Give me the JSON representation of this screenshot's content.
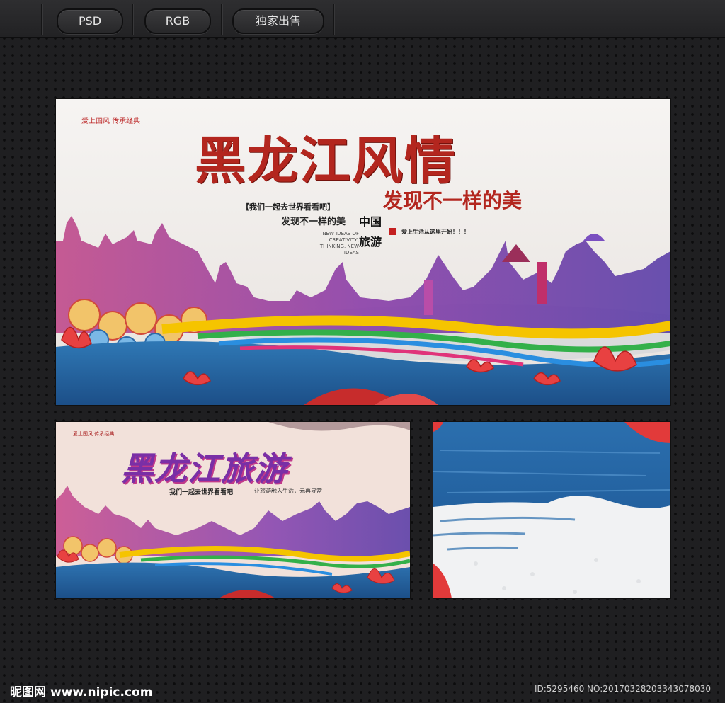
{
  "toolbar": {
    "format_label": "PSD",
    "color_mode_label": "RGB",
    "exclusive_label": "独家出售"
  },
  "poster_main": {
    "tagline_top": "爱上国风 传承经典",
    "title": "黑龙江风情",
    "subtitle": "发现不一样的美",
    "bracket_text": "【我们一起去世界看看吧】",
    "slogan": "发现不一样的美",
    "english_lines": [
      "NEW IDEAS OF",
      "CREATIVITY,",
      "THINKING, NEW IDEAS"
    ],
    "china_label": "中国",
    "travel_label": "旅游",
    "side_note": "爱上生活从这里开始！！！"
  },
  "poster_small": {
    "tagline_top": "爱上国风 传承经典",
    "title": "黑龙江旅游",
    "subtitle": "我们一起去世界看看吧",
    "side_note": "让旅游融入生活，元再寻常"
  },
  "footer": {
    "brand": "昵图网",
    "site": "www.nipic.com",
    "id_text": "ID:5295460 NO:20170328203343078030"
  },
  "colors": {
    "page_bg": "#1f1f21",
    "title_red": "#b3261e",
    "title_purple": "#7a2fa6",
    "water_blue": "#1d5e9a",
    "ribbon_yellow": "#f5c400",
    "ribbon_green": "#33b04a"
  }
}
